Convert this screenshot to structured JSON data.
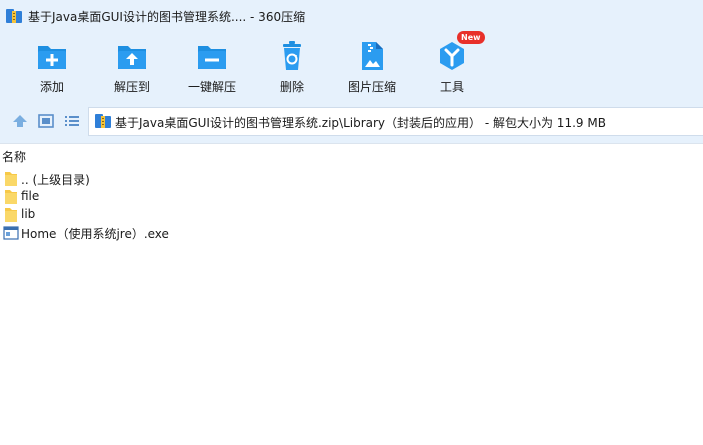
{
  "window": {
    "title": "基于Java桌面GUI设计的图书管理系统.... - 360压缩"
  },
  "toolbar": {
    "items": [
      {
        "label": "添加",
        "icon": "add-icon"
      },
      {
        "label": "解压到",
        "icon": "extract-to-icon"
      },
      {
        "label": "一键解压",
        "icon": "one-click-extract-icon"
      },
      {
        "label": "删除",
        "icon": "delete-icon"
      },
      {
        "label": "图片压缩",
        "icon": "image-compress-icon"
      },
      {
        "label": "工具",
        "icon": "tools-icon",
        "badge": "New"
      }
    ]
  },
  "address": {
    "path": "基于Java桌面GUI设计的图书管理系统.zip\\Library（封装后的应用） - 解包大小为 11.9 MB"
  },
  "list": {
    "column_name": "名称",
    "rows": [
      {
        "name": ".. (上级目录)",
        "type": "folder"
      },
      {
        "name": "file",
        "type": "folder"
      },
      {
        "name": "lib",
        "type": "folder"
      },
      {
        "name": "Home（使用系统jre）.exe",
        "type": "exe"
      }
    ]
  },
  "colors": {
    "accent": "#1e8fe1",
    "chrome_bg": "#e6f1fc",
    "badge": "#e8302a",
    "folder": "#f7c948"
  }
}
